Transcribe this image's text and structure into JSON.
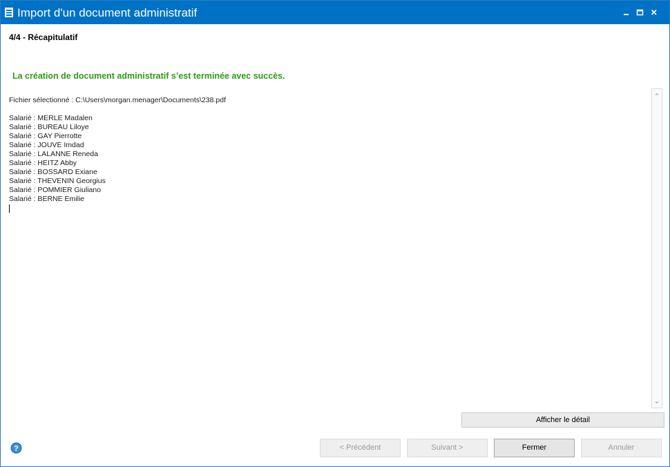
{
  "window": {
    "title": "Import d'un document administratif",
    "controls": {
      "minimize": "_",
      "maximize": "▫",
      "close": "✕"
    },
    "accent_color": "#0072c6"
  },
  "wizard": {
    "step_title": "4/4 - Récapitulatif",
    "success_message": "La création de document administratif s’est terminée avec succès.",
    "success_color": "#2f9a18"
  },
  "summary": {
    "file_line": "Fichier sélectionné : C:\\Users\\morgan.menager\\Documents\\238.pdf",
    "employees": [
      "Salarié : MERLE Madalen",
      "Salarié : BUREAU Liloye",
      "Salarié : GAY Pierrotte",
      "Salarié : JOUVE Imdad",
      "Salarié : LALANNE Reneda",
      "Salarié : HEITZ Abby",
      "Salarié : BOSSARD Exiane",
      "Salarié : THEVENIN Georgius",
      "Salarié : POMMIER Giuliano",
      "Salarié : BERNE Emilie"
    ]
  },
  "buttons": {
    "detail": "Afficher le détail",
    "previous": "< Précédent",
    "next": "Suivant >",
    "close": "Fermer",
    "cancel": "Annuler"
  },
  "icons": {
    "app": "menu-list-icon",
    "help": "help-question-icon",
    "scroll_up": "chevron-up-icon",
    "scroll_down": "chevron-down-icon"
  }
}
